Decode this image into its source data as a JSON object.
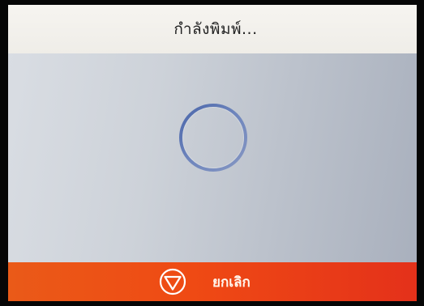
{
  "screen": {
    "title": "กำลังพิมพ์..."
  },
  "progress": {
    "type": "indeterminate-spinner",
    "icon": "spinner-ring-icon"
  },
  "action_bar": {
    "cancel_label": "ยกเลิก",
    "cancel_icon": "stop-icon"
  },
  "colors": {
    "title_bar": "#f3f1ec",
    "content_background": "#c8cdd4",
    "spinner": "#5a74b4",
    "action_bar": "#ec4716",
    "action_text": "#fff6ee"
  }
}
